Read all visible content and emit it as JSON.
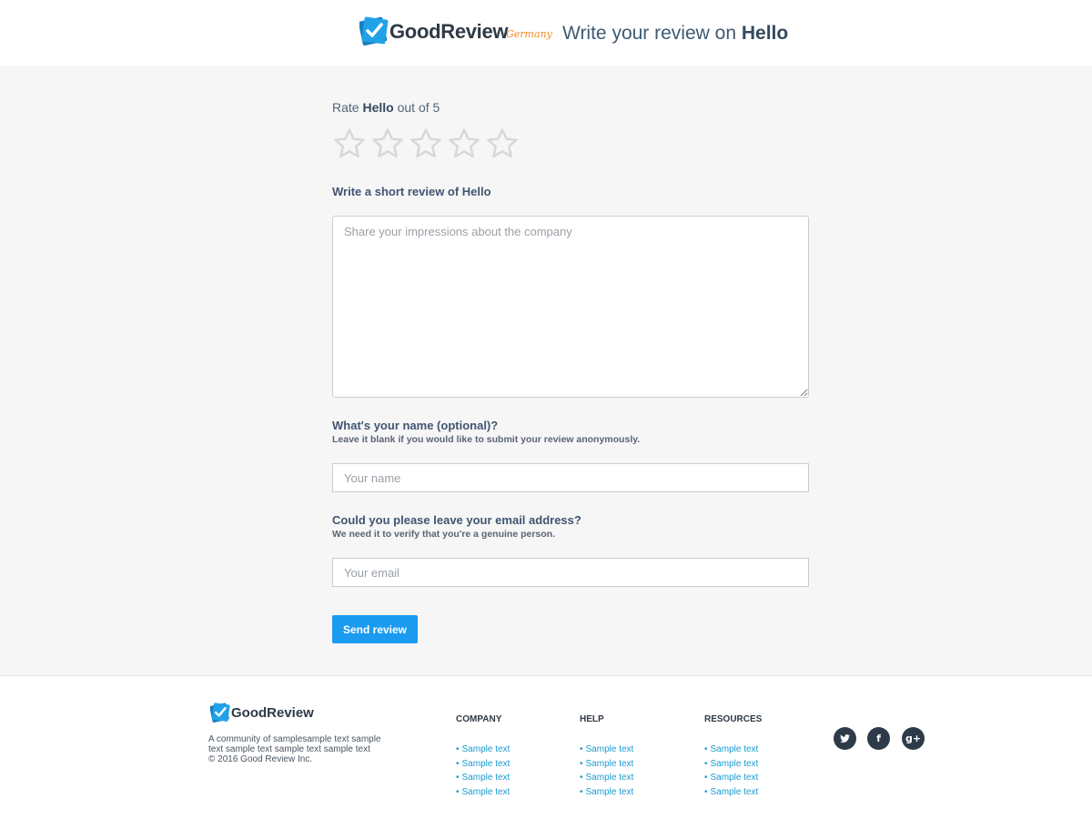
{
  "header": {
    "brand_name": "GoodReview",
    "brand_country": "Germany",
    "title_prefix": "Write your review on",
    "title_company": "Hello"
  },
  "rating": {
    "prefix": "Rate",
    "company": "Hello",
    "suffix": "out of 5",
    "max": 5,
    "value": 0,
    "star_empty_color": "#d8d8d8"
  },
  "review": {
    "label": "Write a short review of Hello",
    "placeholder": "Share your impressions about the company",
    "value": ""
  },
  "name": {
    "label": "What's your name (optional)?",
    "hint": "Leave it blank if you would like to submit your review anonymously.",
    "placeholder": "Your name",
    "value": ""
  },
  "email": {
    "label": "Could you please leave your email address?",
    "hint": "We need it to verify that you're a genuine person.",
    "placeholder": "Your email",
    "value": ""
  },
  "send_button": {
    "label": "Send review",
    "color": "#1a9bf0"
  },
  "footer": {
    "brand_name": "GoodReview",
    "description": "A community of samplesample text sample text sample text sample text sample text",
    "copyright": "© 2016 Good Review Inc.",
    "columns": [
      {
        "title": "COMPANY",
        "links": [
          "Sample text",
          "Sample text",
          "Sample text",
          "Sample text"
        ]
      },
      {
        "title": "HELP",
        "links": [
          "Sample text",
          "Sample text",
          "Sample text",
          "Sample text"
        ]
      },
      {
        "title": "RESOURCES",
        "links": [
          "Sample text",
          "Sample text",
          "Sample text",
          "Sample text"
        ]
      }
    ],
    "social": [
      {
        "icon": "twitter-icon",
        "label": ""
      },
      {
        "icon": "facebook-icon",
        "label": "f"
      },
      {
        "icon": "google-plus-icon",
        "label": "g+"
      }
    ]
  },
  "colors": {
    "accent": "#1a9bf0",
    "brand_blue": "#1f8fd6",
    "brand_orange": "#f08a24",
    "link": "#1a9bd0"
  }
}
